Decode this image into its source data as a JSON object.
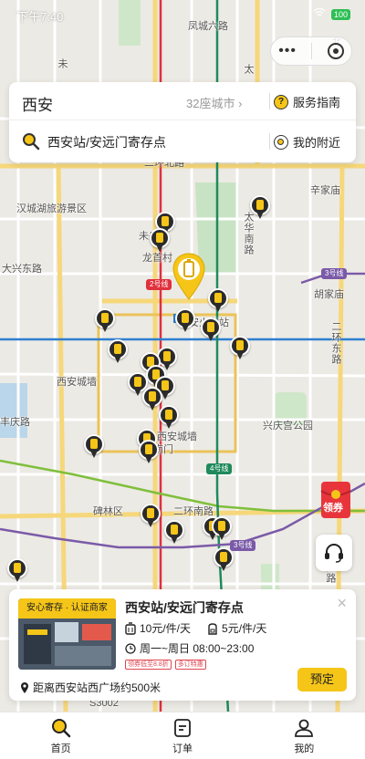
{
  "status_bar": {
    "time": "下午7:40",
    "battery": "100"
  },
  "search": {
    "city": "西安",
    "city_count": "32座城市",
    "city_chevron": "›",
    "service_guide": "服务指南",
    "query": "西安站/安远门寄存点",
    "nearby": "我的附近"
  },
  "map": {
    "labels": {
      "fengcheng": "凤城六路",
      "weiyang": "未",
      "tai": "太",
      "bei": "北",
      "hanchengliu": "汉城湖旅游景区",
      "xinjia": "辛家庙",
      "taihua": "太华南路",
      "weiyangqu": "未央区",
      "longshoucun": "龙首村",
      "daxing": "大兴东路",
      "hujia": "胡家庙",
      "xiancheng": "西安城墙",
      "erhuan": "二环东路",
      "fengqing": "丰庆路",
      "xingqing": "兴庆宫公园",
      "beilin": "碑林区",
      "erhuannan": "二环南路",
      "qujiang": "曲江路",
      "station": "西安火车站",
      "erbei": "二环北路",
      "zhuque": "朱",
      "nanmen": "南门",
      "ring_north_wall": "西安城墙",
      "yongning": "永宁门",
      "road_bottom": "S3002"
    },
    "metro": {
      "line2": "2号线",
      "line3a": "3号线",
      "line4": "4号线",
      "line3b": "3号线"
    }
  },
  "coupon": {
    "label": "领券"
  },
  "store": {
    "badge": "安心寄存 · 认证商家",
    "name": "西安站/安远门寄存点",
    "price_big": "10元/件/天",
    "price_small": "5元/件/天",
    "hours": "周一~周日 08:00~23:00",
    "tags": [
      "领券低至8.8折",
      "多订特惠"
    ],
    "distance": "距离西安站西广场约500米",
    "book_label": "预定",
    "close_label": "×"
  },
  "tabbar": {
    "tabs": [
      {
        "label": "首页"
      },
      {
        "label": "订单"
      },
      {
        "label": "我的"
      }
    ]
  },
  "colors": {
    "accent": "#f5c518",
    "metro_line2": "#e0313c",
    "metro_line3": "#7a5aa8",
    "metro_line4": "#1f8a5b",
    "metro_line1": "#2d7fd1",
    "tag_red": "#e0454f"
  }
}
